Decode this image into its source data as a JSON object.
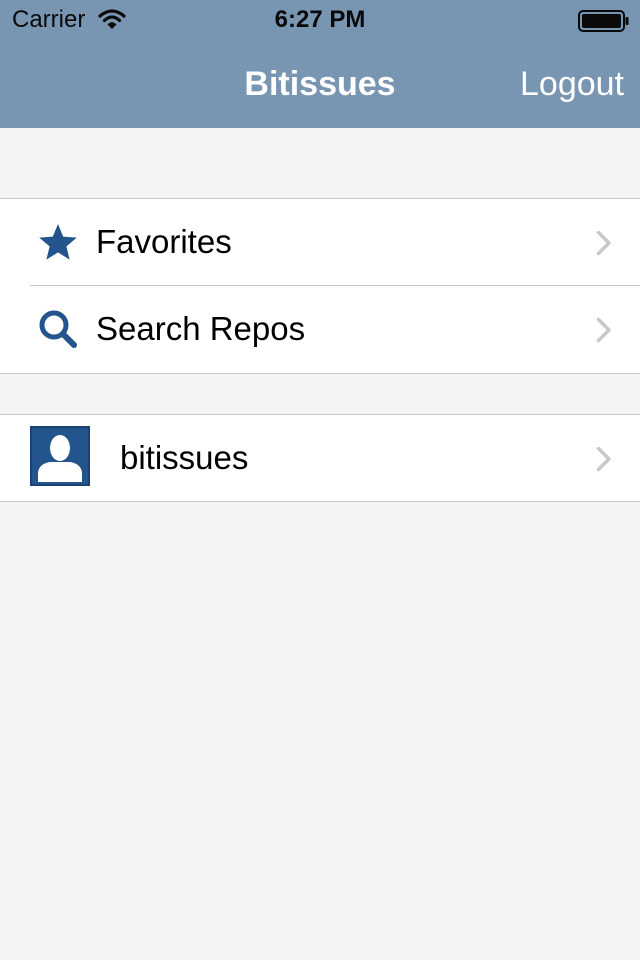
{
  "status_bar": {
    "carrier": "Carrier",
    "time": "6:27 PM",
    "wifi_icon": "wifi-icon",
    "battery_icon": "battery-icon"
  },
  "nav": {
    "title": "Bitissues",
    "logout_label": "Logout"
  },
  "menu": {
    "items": [
      {
        "label": "Favorites",
        "icon": "star-icon"
      },
      {
        "label": "Search Repos",
        "icon": "search-icon"
      }
    ]
  },
  "accounts": {
    "items": [
      {
        "label": "bitissues",
        "icon": "avatar"
      }
    ]
  },
  "colors": {
    "nav_bar": "#7896b2",
    "icon_accent": "#24548c",
    "background": "#f4f4f4",
    "chevron": "#c7c7cc"
  }
}
